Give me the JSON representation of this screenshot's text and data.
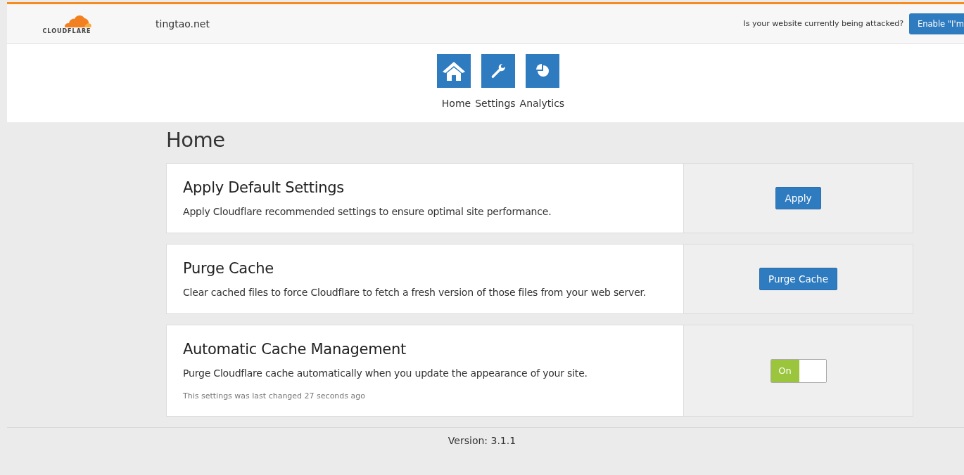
{
  "header": {
    "logo_text": "CLOUDFLARE",
    "domain": "tingtao.net",
    "attack_question": "Is your website currently being attacked?",
    "attack_button": "Enable \"I'm"
  },
  "nav": [
    {
      "kind": "home",
      "label": "Home"
    },
    {
      "kind": "settings",
      "label": "Settings"
    },
    {
      "kind": "analytics",
      "label": "Analytics"
    }
  ],
  "page_title": "Home",
  "cards": [
    {
      "kind": "button",
      "title": "Apply Default Settings",
      "description": "Apply Cloudflare recommended settings to ensure optimal site performance.",
      "button": "Apply"
    },
    {
      "kind": "button",
      "title": "Purge Cache",
      "description": "Clear cached files to force Cloudflare to fetch a fresh version of those files from your web server.",
      "button": "Purge Cache"
    },
    {
      "kind": "toggle",
      "title": "Automatic Cache Management",
      "description": "Purge Cloudflare cache automatically when you update the appearance of your site.",
      "note": "This settings was last changed 27 seconds ago",
      "toggle": {
        "label": "On",
        "on": true
      }
    }
  ],
  "version": "Version: 3.1.1"
}
